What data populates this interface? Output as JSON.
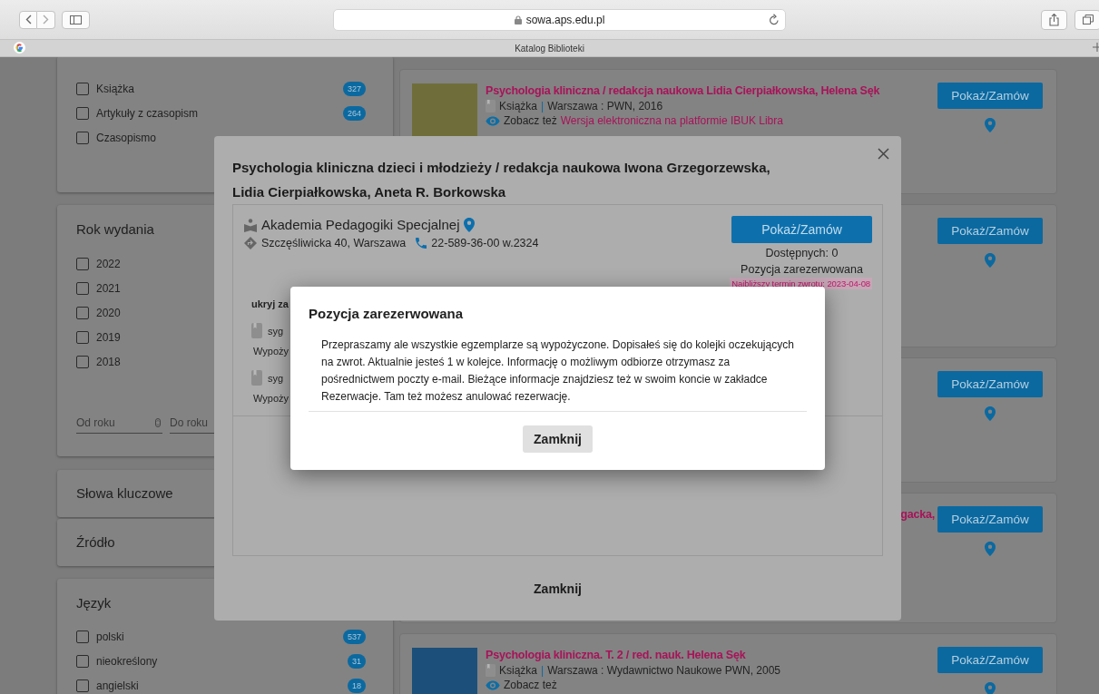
{
  "browser": {
    "url": "sowa.aps.edu.pl",
    "tab_title": "Katalog Biblioteki"
  },
  "sidebar": {
    "sections": [
      {
        "kind": "checklist",
        "items": [
          {
            "label": "Książka",
            "count": "327",
            "checked": false
          },
          {
            "label": "Artykuły z czasopism",
            "count": "264",
            "checked": false
          },
          {
            "label": "Czasopismo",
            "checked": false
          }
        ]
      },
      {
        "kind": "years",
        "title": "Rok wydania",
        "items": [
          {
            "label": "2022",
            "checked": false
          },
          {
            "label": "2021",
            "checked": false
          },
          {
            "label": "2020",
            "checked": false
          },
          {
            "label": "2019",
            "checked": false
          },
          {
            "label": "2018",
            "checked": false
          }
        ],
        "from_placeholder": "Od roku",
        "to_placeholder": "Do roku"
      },
      {
        "kind": "collapsed",
        "title": "Słowa kluczowe"
      },
      {
        "kind": "collapsed",
        "title": "Źródło"
      },
      {
        "kind": "checklist",
        "title": "Język",
        "items": [
          {
            "label": "polski",
            "count": "537",
            "checked": false
          },
          {
            "label": "nieokreślony",
            "count": "31",
            "checked": false
          },
          {
            "label": "angielski",
            "count": "18",
            "checked": false
          }
        ]
      }
    ]
  },
  "results": [
    {
      "has_cover": true,
      "title": "Psychologia kliniczna / redakcja naukowa Lidia Cierpiałkowska, Helena Sęk",
      "type": "Książka",
      "separator": "|",
      "publisher": "Warszawa : PWN, 2016",
      "see_also_label": "Zobacz też",
      "see_also_link": "Wersja elektroniczna na platformie IBUK Libra",
      "button": "Pokaż/Zamów"
    },
    {
      "has_cover": false,
      "button": "Pokaż/Zamów"
    },
    {
      "has_cover": false,
      "button": "Pokaż/Zamów"
    },
    {
      "has_cover": false,
      "title": "gacka,",
      "button": "Pokaż/Zamów"
    },
    {
      "has_cover": true,
      "title": "Psychologia kliniczna. T. 2 / red. nauk. Helena Sęk",
      "type": "Książka",
      "separator": "|",
      "publisher": "Warszawa : Wydawnictwo Naukowe PWN, 2005",
      "see_also_label": "Zobacz też",
      "button": "Pokaż/Zamów"
    }
  ],
  "modal": {
    "title": "Psychologia kliniczna dzieci i młodzieży / redakcja naukowa Iwona Grzegorzewska, Lidia Cierpiałkowska, Aneta R. Borkowska",
    "library": "Akademia Pedagogiki Specjalnej",
    "address": "Szczęśliwicka 40, Warszawa",
    "phone": "22-589-36-00 w.2324",
    "button": "Pokaż/Zamów",
    "available": "Dostępnych: 0",
    "status": "Pozycja zarezerwowana",
    "due": "Najbliższy termin zwrotu: 2023-04-08",
    "toggle": "ukryj za",
    "copies": [
      {
        "signature": "syg",
        "status": "Wypoży"
      },
      {
        "signature": "syg",
        "status": "Wypoży"
      }
    ],
    "close": "Zamknij"
  },
  "alert": {
    "title": "Pozycja zarezerwowana",
    "message": "Przepraszamy ale wszystkie egzemplarze są wypożyczone. Dopisałeś się do kolejki oczekujących na zwrot. Aktualnie jesteś 1 w kolejce. Informację o możliwym odbiorze otrzymasz za pośrednictwem poczty e-mail. Bieżące informacje znajdziesz też w swoim koncie w zakładce Rezerwacje. Tam też możesz anulować rezerwację.",
    "button": "Zamknij"
  }
}
